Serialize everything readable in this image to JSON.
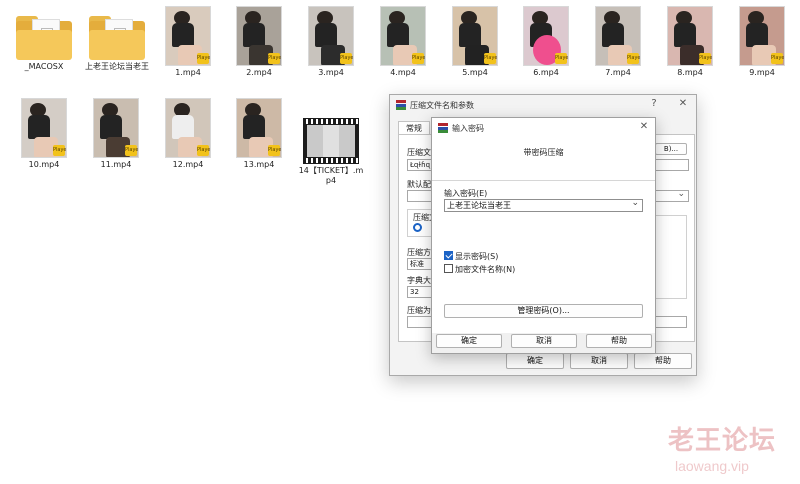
{
  "files": [
    {
      "name": "_MACOSX",
      "kind": "folder"
    },
    {
      "name": "上老王论坛当老王",
      "kind": "folder"
    },
    {
      "name": "1.mp4",
      "kind": "video"
    },
    {
      "name": "2.mp4",
      "kind": "video"
    },
    {
      "name": "3.mp4",
      "kind": "video"
    },
    {
      "name": "4.mp4",
      "kind": "video"
    },
    {
      "name": "5.mp4",
      "kind": "video"
    },
    {
      "name": "6.mp4",
      "kind": "video"
    },
    {
      "name": "7.mp4",
      "kind": "video"
    },
    {
      "name": "8.mp4",
      "kind": "video"
    },
    {
      "name": "9.mp4",
      "kind": "video"
    },
    {
      "name": "10.mp4",
      "kind": "video"
    },
    {
      "name": "11.mp4",
      "kind": "video"
    },
    {
      "name": "12.mp4",
      "kind": "video"
    },
    {
      "name": "13.mp4",
      "kind": "video"
    },
    {
      "name": "14【TICKET】.mp4",
      "kind": "video-film"
    }
  ],
  "thumb_badge": "Player",
  "archive_dialog": {
    "title": "压缩文件名和参数",
    "help_glyph": "?",
    "close_glyph": "✕",
    "tab_general": "常规",
    "archive_name_label": "压缩文",
    "archive_name_value": "Łɋɫɦɋ",
    "browse_fragment": "B)...",
    "default_profile_label": "默认配",
    "format_group_label": "压缩文",
    "method_label": "压缩方",
    "method_value": "标准",
    "dict_label": "字典大",
    "dict_value": "32",
    "split_label": "压缩为",
    "ok": "确定",
    "cancel": "取消",
    "help": "帮助"
  },
  "password_dialog": {
    "title": "输入密码",
    "close_glyph": "✕",
    "subtitle": "带密码压缩",
    "password_label": "输入密码(E)",
    "password_value": "上老王论坛当老王",
    "show_password_label": "显示密码(S)",
    "show_password_checked": true,
    "encrypt_names_label": "加密文件名称(N)",
    "encrypt_names_checked": false,
    "manage_button": "管理密码(O)...",
    "ok": "确定",
    "cancel": "取消",
    "help": "帮助"
  },
  "watermark": {
    "line1": "老王论坛",
    "line2": "laowang.vip"
  },
  "colors": {
    "rar_red": "#b3262d",
    "rar_blue": "#2d4fa8",
    "rar_green": "#3a8c3a",
    "accent": "#1b63c6"
  }
}
